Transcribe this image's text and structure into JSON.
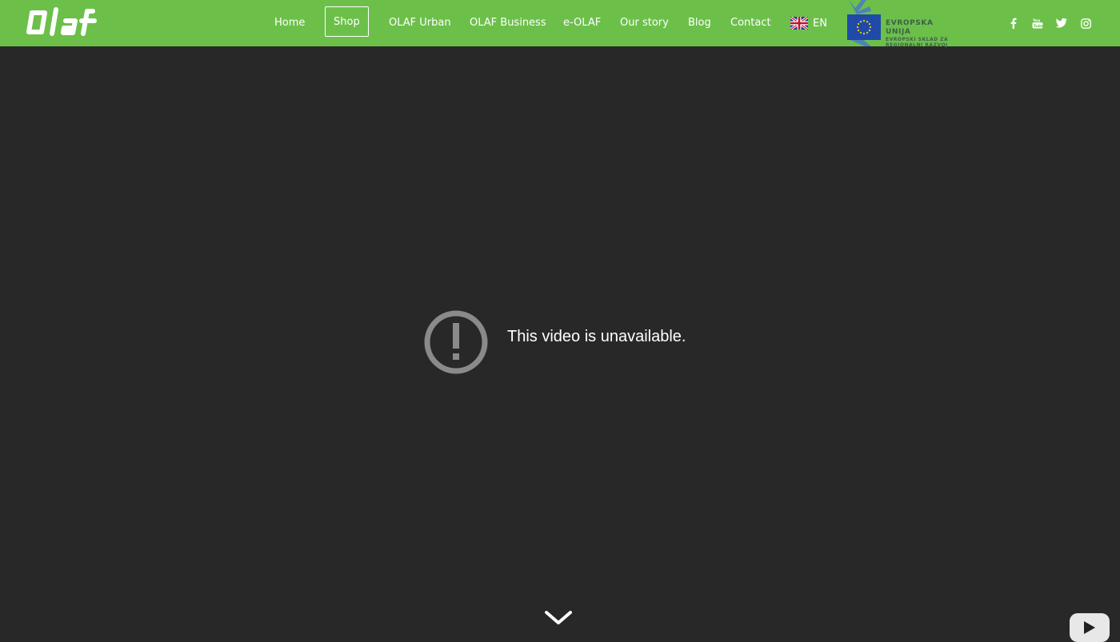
{
  "header": {
    "brand": "Olaf",
    "nav": [
      {
        "label": "Home"
      },
      {
        "label": "Shop"
      },
      {
        "label": "OLAF Urban"
      },
      {
        "label": "OLAF Business"
      },
      {
        "label": "e-OLAF"
      },
      {
        "label": "Our story"
      },
      {
        "label": "Blog"
      },
      {
        "label": "Contact"
      }
    ],
    "active_nav": "Shop",
    "language": {
      "code": "EN",
      "icon": "uk-flag-icon"
    },
    "eu_badge": {
      "title": "EVROPSKA UNIJA",
      "line1": "EVROPSKI SKLAD ZA",
      "line2": "REGIONALNI RAZVOJ"
    },
    "social": [
      "facebook-icon",
      "youtube-icon",
      "twitter-icon",
      "instagram-icon"
    ]
  },
  "video": {
    "message": "This video is unavailable.",
    "icon": "alert-icon",
    "scroll_icon": "chevron-down-icon",
    "player_icon": "youtube-play-icon"
  },
  "colors": {
    "header_bg": "#6cc04a",
    "page_bg": "#282828",
    "eu_blue": "#1f4aa8"
  }
}
